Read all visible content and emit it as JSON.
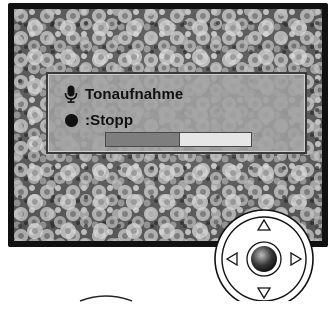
{
  "dialog": {
    "title": "Tonaufnahme",
    "status": ":Stopp",
    "progress": 0.51
  },
  "icons": {
    "microphone": "microphone-icon",
    "record": "record-dot-icon"
  },
  "controller": {
    "up": "up-arrow-icon",
    "down": "down-arrow-icon",
    "left": "left-arrow-icon",
    "right": "right-arrow-icon",
    "center": "center-button"
  },
  "colors": {
    "dialog_bg": "#a0a0a0",
    "progress_fill": "#7e7e7e",
    "progress_track": "#e6e6e6"
  }
}
